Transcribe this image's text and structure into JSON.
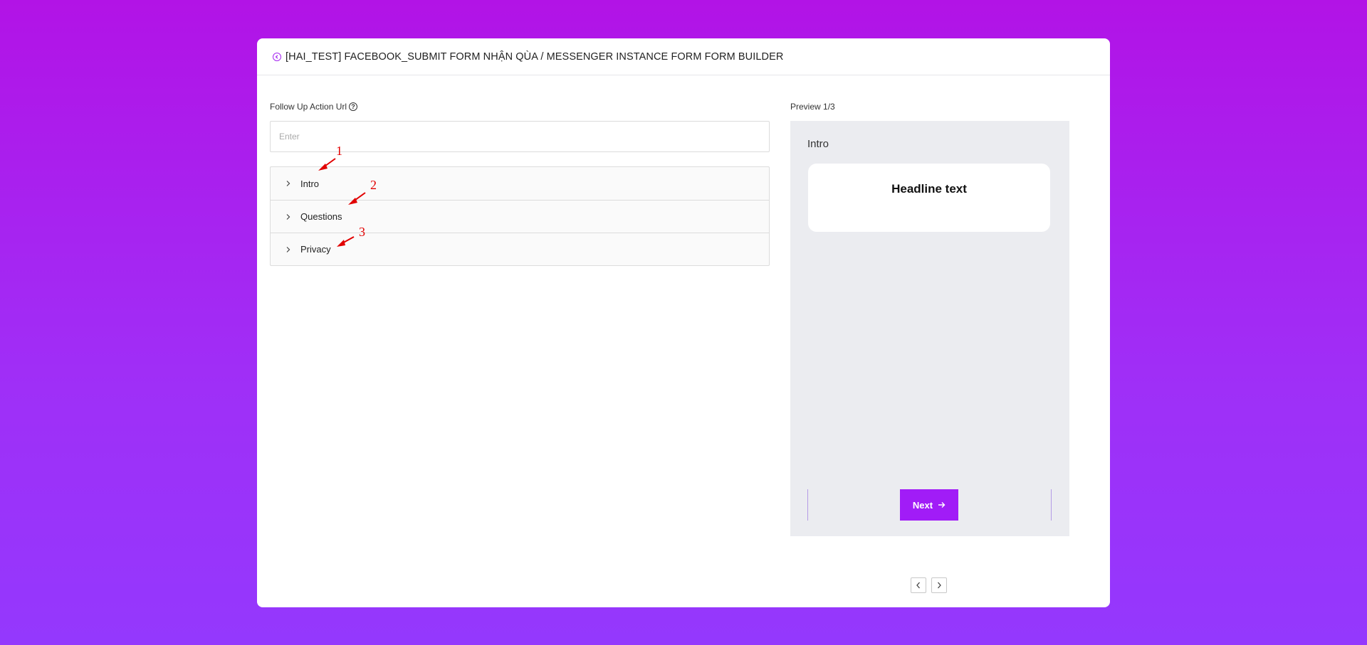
{
  "header": {
    "back_icon": "chevron-left-circle-icon",
    "title": "[HAI_TEST] FACEBOOK_SUBMIT FORM NHẬN QÙA / MESSENGER INSTANCE FORM FORM BUILDER"
  },
  "form": {
    "follow_up_label": "Follow Up Action Url",
    "help_icon": "question-circle-icon",
    "follow_up_value": "",
    "follow_up_placeholder": "Enter"
  },
  "accordion": {
    "items": [
      {
        "label": "Intro",
        "icon": "chevron-right-icon"
      },
      {
        "label": "Questions",
        "icon": "chevron-right-icon"
      },
      {
        "label": "Privacy",
        "icon": "chevron-right-icon"
      }
    ]
  },
  "annotations": [
    "1",
    "2",
    "3"
  ],
  "preview": {
    "label": "Preview 1/3",
    "section_title": "Intro",
    "headline": "Headline text",
    "next_label": "Next",
    "next_icon": "arrow-right-icon",
    "prev_page_icon": "chevron-left-icon",
    "next_page_icon": "chevron-right-icon"
  },
  "colors": {
    "accent": "#a11cf7",
    "background_top": "#b213e6",
    "background_bottom": "#9438fd",
    "annotation": "#e10000"
  }
}
